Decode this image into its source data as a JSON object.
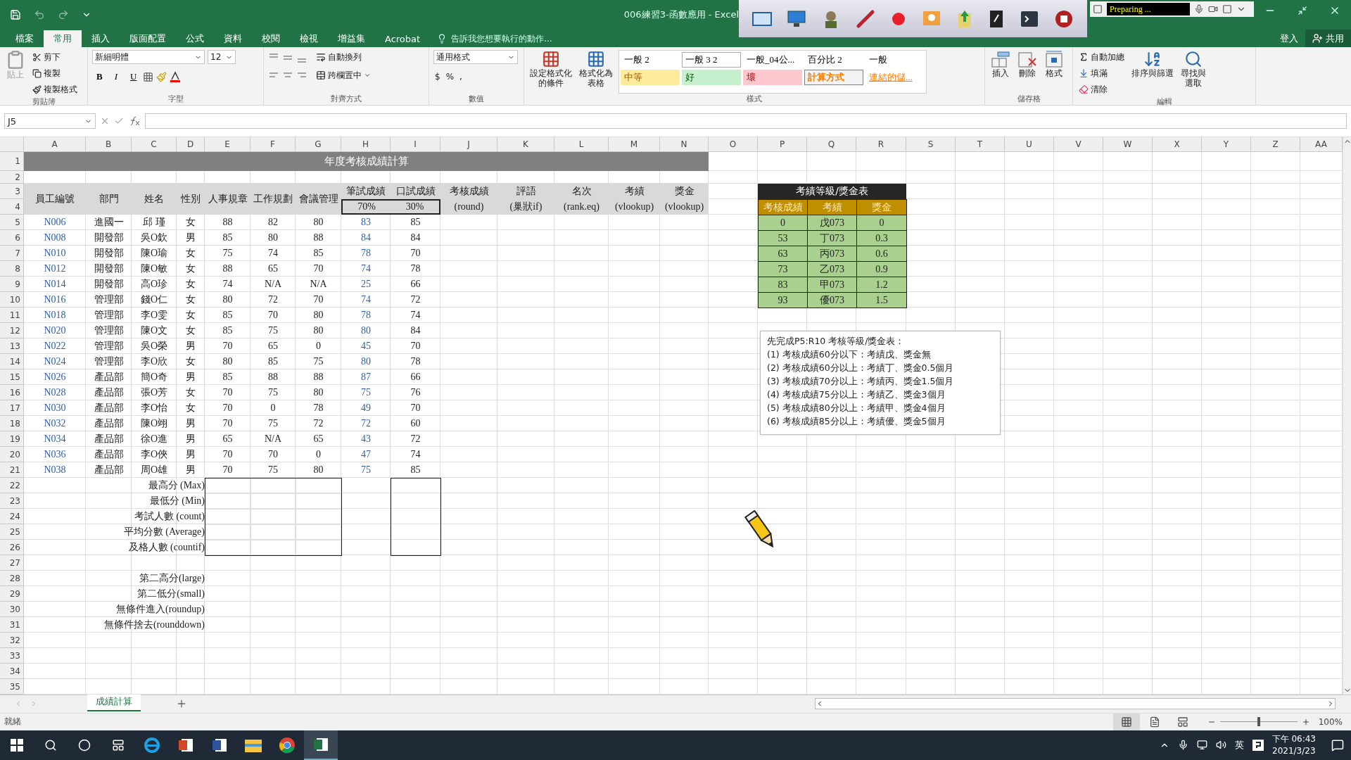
{
  "title_bar": {
    "title": "006練習3-函數應用 - Excel"
  },
  "recorder": {
    "status": "Preparing ..."
  },
  "account": {
    "sign_in": "登入",
    "share": "共用"
  },
  "tabs": [
    {
      "label": "檔案",
      "selected": false
    },
    {
      "label": "常用",
      "selected": true
    },
    {
      "label": "插入",
      "selected": false
    },
    {
      "label": "版面配置",
      "selected": false
    },
    {
      "label": "公式",
      "selected": false
    },
    {
      "label": "資料",
      "selected": false
    },
    {
      "label": "校閱",
      "selected": false
    },
    {
      "label": "檢視",
      "selected": false
    },
    {
      "label": "增益集",
      "selected": false
    },
    {
      "label": "Acrobat",
      "selected": false
    }
  ],
  "tell_me": {
    "placeholder": "告訴我您想要執行的動作..."
  },
  "ribbon": {
    "clipboard": {
      "label": "剪貼簿",
      "paste": "貼上",
      "cut": "剪下",
      "copy": "複製",
      "format_painter": "複製格式"
    },
    "font": {
      "label": "字型",
      "font_name": "新細明體",
      "font_size": "12",
      "bold": "B",
      "italic": "I",
      "underline": "U"
    },
    "alignment": {
      "label": "對齊方式",
      "wrap_text": "自動換列",
      "merge_center": "跨欄置中"
    },
    "number": {
      "label": "數值",
      "format": "通用格式",
      "currency": "$",
      "percent": "%",
      "comma": ","
    },
    "styles": {
      "label": "樣式",
      "conditional": [
        "設定格式化",
        "的條件"
      ],
      "format_table": [
        "格式化為",
        "表格"
      ],
      "gallery": [
        {
          "label": "一般 2",
          "kind": "plain"
        },
        {
          "label": "一般 3 2",
          "kind": "boxed"
        },
        {
          "label": "一般_04公...",
          "kind": "plain"
        },
        {
          "label": "百分比 2",
          "kind": "plain"
        },
        {
          "label": "一般",
          "kind": "plain"
        },
        {
          "label": "中等",
          "kind": "neutral"
        },
        {
          "label": "好",
          "kind": "good"
        },
        {
          "label": "壞",
          "kind": "bad"
        },
        {
          "label": "計算方式",
          "kind": "calculation"
        },
        {
          "label": "連結的儲...",
          "kind": "linked"
        }
      ]
    },
    "cells": {
      "label": "儲存格",
      "buttons": [
        {
          "label": "插入",
          "kind": "insert"
        },
        {
          "label": "刪除",
          "kind": "delete"
        },
        {
          "label": "格式",
          "kind": "format"
        }
      ]
    },
    "editing": {
      "label": "編輯",
      "autosum": "自動加總",
      "fill": "填滿",
      "clear": "清除",
      "sort": "排序與篩選",
      "find": [
        "尋找與",
        "選取"
      ]
    }
  },
  "formula_bar": {
    "name_box": "J5"
  },
  "sheet": {
    "column_letters": [
      "A",
      "B",
      "C",
      "D",
      "E",
      "F",
      "G",
      "H",
      "I",
      "J",
      "K",
      "L",
      "M",
      "N",
      "O",
      "P",
      "Q",
      "R",
      "S",
      "T",
      "U",
      "V",
      "W",
      "X",
      "Y",
      "Z",
      "AA"
    ],
    "row_numbers": [
      "1",
      "2",
      "3",
      "4",
      "5",
      "6",
      "7",
      "8",
      "9",
      "10",
      "11",
      "12",
      "13",
      "14",
      "15",
      "16",
      "17",
      "18",
      "19",
      "20",
      "21",
      "22",
      "23",
      "24",
      "25",
      "26",
      "27",
      "28",
      "29",
      "30",
      "31",
      "32",
      "33",
      "34",
      "35"
    ],
    "title": "年度考核成績計算",
    "headers": [
      {
        "kind": "merged",
        "label": "員工編號"
      },
      {
        "kind": "merged",
        "label": "部門"
      },
      {
        "kind": "merged",
        "label": "姓名"
      },
      {
        "kind": "merged",
        "label": "性別"
      },
      {
        "kind": "merged",
        "label": "人事規章"
      },
      {
        "kind": "merged",
        "label": "工作規劃"
      },
      {
        "kind": "merged",
        "label": "會議管理"
      },
      {
        "kind": "weighted",
        "label": "筆試成績",
        "weight": "70%"
      },
      {
        "kind": "weighted",
        "label": "口試成績",
        "weight": "30%"
      },
      {
        "kind": "noted",
        "label": "考核成績",
        "note": "(round)"
      },
      {
        "kind": "noted",
        "label": "評語",
        "note": "(巢狀if)"
      },
      {
        "kind": "noted",
        "label": "名次",
        "note": "(rank.eq)"
      },
      {
        "kind": "noted",
        "label": "考績",
        "note": "(vlookup)"
      },
      {
        "kind": "noted",
        "label": "獎金",
        "note": "(vlookup)"
      }
    ],
    "employees": [
      [
        "N006",
        "進國一",
        "邱 瑾",
        "女",
        "88",
        "82",
        "80",
        "83",
        "85"
      ],
      [
        "N008",
        "開發部",
        "吳O欽",
        "男",
        "85",
        "80",
        "88",
        "84",
        "84"
      ],
      [
        "N010",
        "開發部",
        "陳O瑜",
        "女",
        "75",
        "74",
        "85",
        "78",
        "70"
      ],
      [
        "N012",
        "開發部",
        "陳O敏",
        "女",
        "88",
        "65",
        "70",
        "74",
        "78"
      ],
      [
        "N014",
        "開發部",
        "高O珍",
        "女",
        "74",
        "N/A",
        "N/A",
        "25",
        "66"
      ],
      [
        "N016",
        "管理部",
        "錢O仁",
        "女",
        "80",
        "72",
        "70",
        "74",
        "72"
      ],
      [
        "N018",
        "管理部",
        "李O雯",
        "女",
        "85",
        "70",
        "80",
        "78",
        "74"
      ],
      [
        "N020",
        "管理部",
        "陳O文",
        "女",
        "85",
        "75",
        "80",
        "80",
        "84"
      ],
      [
        "N022",
        "管理部",
        "吳O榮",
        "男",
        "70",
        "65",
        "0",
        "45",
        "70"
      ],
      [
        "N024",
        "管理部",
        "李O欣",
        "女",
        "80",
        "85",
        "75",
        "80",
        "78"
      ],
      [
        "N026",
        "產品部",
        "簡O奇",
        "男",
        "85",
        "88",
        "88",
        "87",
        "66"
      ],
      [
        "N028",
        "產品部",
        "張O芳",
        "女",
        "70",
        "75",
        "80",
        "75",
        "76"
      ],
      [
        "N030",
        "產品部",
        "李O怡",
        "女",
        "70",
        "0",
        "78",
        "49",
        "70"
      ],
      [
        "N032",
        "產品部",
        "陳O翊",
        "男",
        "70",
        "75",
        "72",
        "72",
        "60"
      ],
      [
        "N034",
        "產品部",
        "徐O進",
        "男",
        "65",
        "N/A",
        "65",
        "43",
        "72"
      ],
      [
        "N036",
        "產品部",
        "李O俠",
        "男",
        "70",
        "70",
        "0",
        "47",
        "74"
      ],
      [
        "N038",
        "產品部",
        "周O雄",
        "男",
        "70",
        "75",
        "80",
        "75",
        "85"
      ]
    ],
    "summary_labels": [
      "最高分 (Max)",
      "最低分 (Min)",
      "考試人數 (count)",
      "平均分數 (Average)",
      "及格人數 (countif)"
    ],
    "extra_labels": [
      "第二高分(large)",
      "第二低分(small)",
      "無條件進入(roundup)",
      "無條件捨去(rounddown)"
    ],
    "lookup": {
      "title": "考績等級/獎金表",
      "columns": [
        "考核成績",
        "考績",
        "獎金"
      ],
      "rows": [
        [
          "0",
          "戊073",
          "0"
        ],
        [
          "53",
          "丁073",
          "0.3"
        ],
        [
          "63",
          "丙073",
          "0.6"
        ],
        [
          "73",
          "乙073",
          "0.9"
        ],
        [
          "83",
          "甲073",
          "1.2"
        ],
        [
          "93",
          "優073",
          "1.5"
        ]
      ]
    },
    "note": {
      "lines": [
        "先完成P5:R10 考核等級/獎金表：",
        "(1) 考核成績60分以下：考績戊、獎金無",
        "(2) 考核成績60分以上：考績丁、獎金0.5個月",
        "(3) 考核成績70分以上：考績丙、獎金1.5個月",
        "(4) 考核成績75分以上：考績乙、獎金3個月",
        "(5) 考核成績80分以上：考績甲、獎金4個月",
        "(6) 考核成績85分以上：考績優、獎金5個月"
      ]
    }
  },
  "sheet_tabs": [
    {
      "label": "成績計算",
      "selected": true
    }
  ],
  "status_bar": {
    "status": "就緒",
    "views": [
      {
        "kind": "normal",
        "selected": true
      },
      {
        "kind": "page_layout",
        "selected": false
      },
      {
        "kind": "page_break",
        "selected": false
      }
    ],
    "zoom_slider": {
      "level": 0.5
    },
    "zoom": "100%"
  },
  "taskbar": {
    "apps": [
      {
        "kind": "ie",
        "selected": false
      },
      {
        "kind": "powerpoint",
        "selected": false
      },
      {
        "kind": "word",
        "selected": false
      },
      {
        "kind": "explorer",
        "selected": false
      },
      {
        "kind": "chrome",
        "selected": false
      },
      {
        "kind": "excel",
        "selected": true
      }
    ],
    "ime": "英",
    "time": "下午 06:43",
    "date": "2021/3/23"
  }
}
